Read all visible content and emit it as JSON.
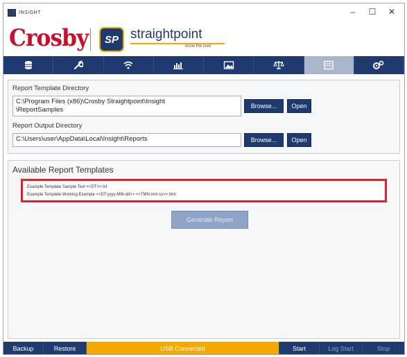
{
  "window": {
    "title": "INSIGHT",
    "minimize": "–",
    "maximize": "☐",
    "close": "✕"
  },
  "header": {
    "crosby_logo": "Crosby",
    "sp_badge": "SP",
    "sp_name": "straightpoint",
    "sp_tagline": "know the load"
  },
  "toolbar": {
    "items": [
      {
        "icon": "database-icon",
        "active": false
      },
      {
        "icon": "wrench-icon",
        "active": false
      },
      {
        "icon": "wireless-icon",
        "active": false
      },
      {
        "icon": "chart-icon",
        "active": false
      },
      {
        "icon": "image-icon",
        "active": false
      },
      {
        "icon": "scales-icon",
        "active": false
      },
      {
        "icon": "report-icon",
        "active": true
      },
      {
        "icon": "settings-icon",
        "active": false
      }
    ]
  },
  "directories": {
    "template_label": "Report Template Directory",
    "template_path_line1": "C:\\Program Files (x86)\\Crosby Straightpoint\\Insight",
    "template_path_line2": "\\ReportSamples",
    "output_label": "Report Output Directory",
    "output_path": "C:\\Users\\user\\AppData\\Local\\Insight\\Reports",
    "browse_label": "Browse...",
    "open_label": "Open"
  },
  "templates": {
    "title": "Available Report Templates",
    "items": [
      "Example Template Sample Text <<DT>>.txt",
      "Example Template Working Example <<DT:yyyy-MM-dd>> <<TMN:mm:ss>>.htm"
    ],
    "generate_label": "Generate Report"
  },
  "statusbar": {
    "backup": "Backup",
    "restore": "Restore",
    "status": "USB Connected",
    "start": "Start",
    "log_start": "Log Start",
    "stop": "Stop"
  },
  "colors": {
    "brand_navy": "#1f3a6f",
    "crosby_red": "#c8102e",
    "accent_orange": "#f2a900",
    "highlight_red": "#e0212b"
  }
}
